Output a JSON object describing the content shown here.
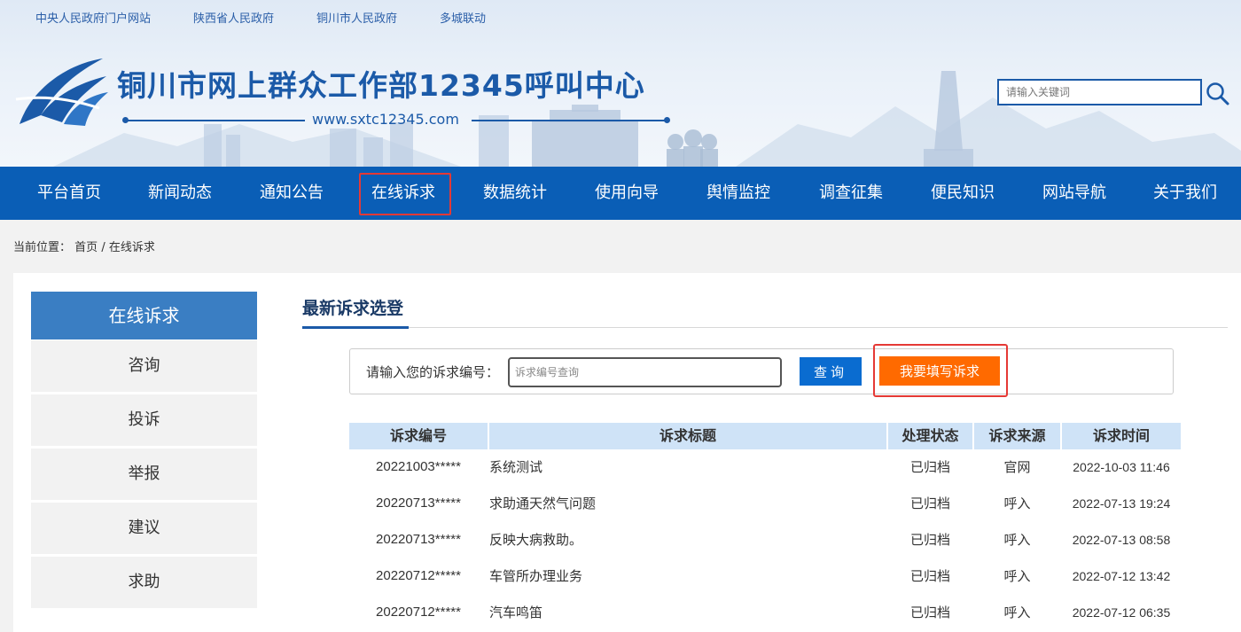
{
  "top_links": [
    "中央人民政府门户网站",
    "陕西省人民政府",
    "铜川市人民政府",
    "多城联动"
  ],
  "site": {
    "title": "铜川市网上群众工作部12345呼叫中心",
    "url": "www.sxtc12345.com"
  },
  "header_search": {
    "placeholder": "请输入关键词"
  },
  "nav": {
    "items": [
      "平台首页",
      "新闻动态",
      "通知公告",
      "在线诉求",
      "数据统计",
      "使用向导",
      "舆情监控",
      "调查征集",
      "便民知识",
      "网站导航",
      "关于我们"
    ],
    "active": "在线诉求"
  },
  "breadcrumb": {
    "label": "当前位置：",
    "home": "首页",
    "sep": "/",
    "current": "在线诉求"
  },
  "sidebar": {
    "title": "在线诉求",
    "items": [
      "咨询",
      "投诉",
      "举报",
      "建议",
      "求助"
    ]
  },
  "main": {
    "title": "最新诉求选登",
    "query_label": "请输入您的诉求编号：",
    "query_placeholder": "诉求编号查询",
    "query_button": "查询",
    "file_button": "我要填写诉求"
  },
  "table": {
    "headers": [
      "诉求编号",
      "诉求标题",
      "处理状态",
      "诉求来源",
      "诉求时间"
    ],
    "rows": [
      [
        "20221003*****",
        "系统测试",
        "已归档",
        "官网",
        "2022-10-03 11:46"
      ],
      [
        "20220713*****",
        "求助通天然气问题",
        "已归档",
        "呼入",
        "2022-07-13 19:24"
      ],
      [
        "20220713*****",
        "反映大病救助。",
        "已归档",
        "呼入",
        "2022-07-13 08:58"
      ],
      [
        "20220712*****",
        "车管所办理业务",
        "已归档",
        "呼入",
        "2022-07-12 13:42"
      ],
      [
        "20220712*****",
        "汽车鸣笛",
        "已归档",
        "呼入",
        "2022-07-12 06:35"
      ]
    ]
  },
  "colors": {
    "brand_blue": "#0a5eb6",
    "accent_orange": "#ff6a00",
    "highlight_red": "#e53935",
    "header_blue": "#cfe3f7"
  }
}
